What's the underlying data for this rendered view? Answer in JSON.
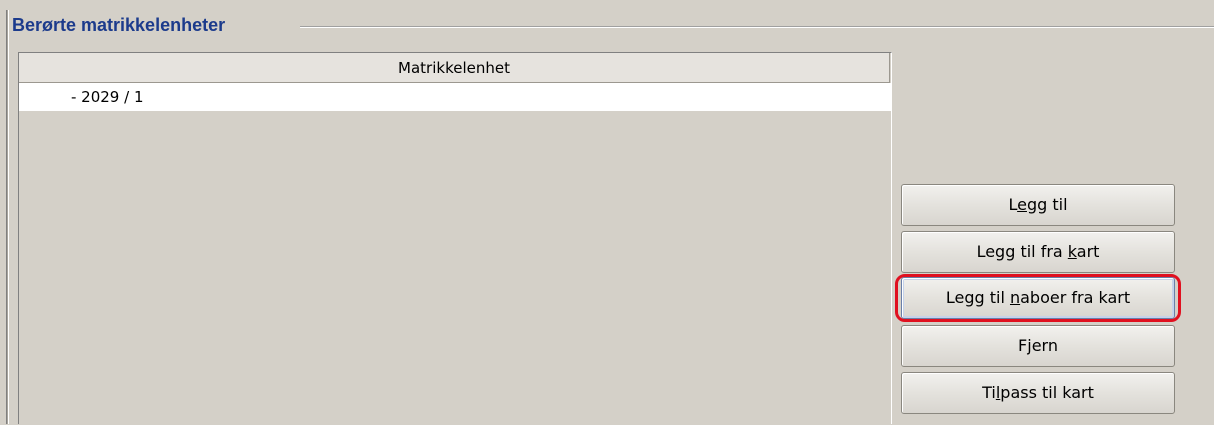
{
  "group": {
    "title": "Berørte matrikkelenheter"
  },
  "table": {
    "columns": [
      "Matrikkelenhet"
    ],
    "rows": [
      {
        "matrikkelenhet": "- 2029 / 1"
      }
    ]
  },
  "buttons": {
    "legg_til": {
      "pre": "L",
      "mnemonic": "e",
      "post": "gg til"
    },
    "legg_til_fra_kart": {
      "pre": "Legg til fra ",
      "mnemonic": "k",
      "post": "art"
    },
    "legg_til_naboer": {
      "pre": "Legg til ",
      "mnemonic": "n",
      "post": "aboer fra kart"
    },
    "fjern": {
      "pre": "F",
      "mnemonic": "j",
      "post": "ern"
    },
    "tilpass": {
      "pre": "Ti",
      "mnemonic": "l",
      "post": "pass til kart"
    }
  },
  "colors": {
    "title": "#1c3b8c",
    "highlight": "#e01020",
    "background": "#d4d0c8"
  }
}
